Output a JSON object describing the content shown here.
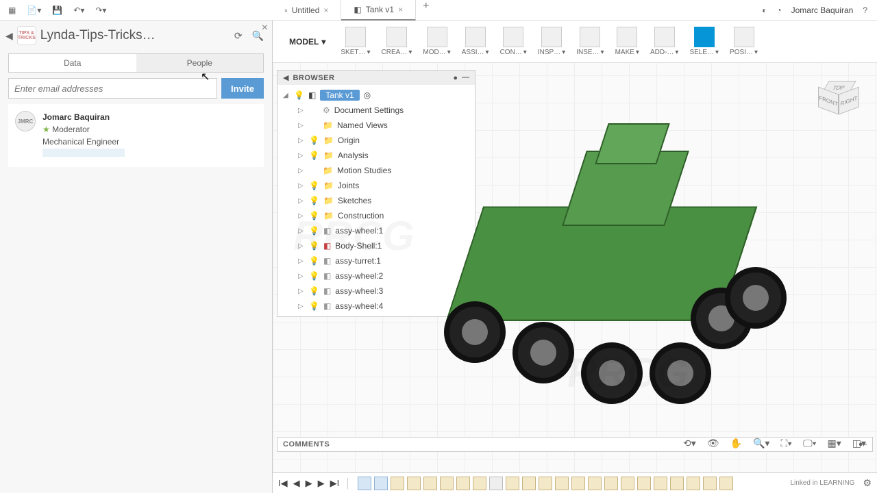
{
  "topbar": {
    "tabs": [
      {
        "label": "Untitled",
        "icon": "document-icon"
      },
      {
        "label": "Tank v1",
        "icon": "component-icon"
      }
    ],
    "user": "Jomarc Baquiran"
  },
  "panel": {
    "title": "Lynda-Tips-Tricks…",
    "logo_text": "TIPS & TRICKS",
    "tabs": {
      "data": "Data",
      "people": "People"
    },
    "invite_placeholder": "Enter email addresses",
    "invite_button": "Invite",
    "person": {
      "avatar_text": "JMRC",
      "name": "Jomarc Baquiran",
      "role": "Moderator",
      "title": "Mechanical Engineer"
    }
  },
  "ribbon": {
    "workspace": "MODEL",
    "groups": [
      "SKET…",
      "CREA…",
      "MOD…",
      "ASSI…",
      "CON…",
      "INSP…",
      "INSE…",
      "MAKE",
      "ADD-…",
      "SELE…",
      "POSI…"
    ]
  },
  "browser": {
    "header": "BROWSER",
    "root": "Tank v1",
    "items": [
      {
        "label": "Document Settings",
        "bulb": null,
        "icon": "gear"
      },
      {
        "label": "Named Views",
        "bulb": null,
        "icon": "folder"
      },
      {
        "label": "Origin",
        "bulb": "off",
        "icon": "folder"
      },
      {
        "label": "Analysis",
        "bulb": "on",
        "icon": "folder"
      },
      {
        "label": "Motion Studies",
        "bulb": null,
        "icon": "folder"
      },
      {
        "label": "Joints",
        "bulb": "on",
        "icon": "folder"
      },
      {
        "label": "Sketches",
        "bulb": "on",
        "icon": "folder"
      },
      {
        "label": "Construction",
        "bulb": "on",
        "icon": "folder"
      },
      {
        "label": "assy-wheel:1",
        "bulb": "on",
        "icon": "component"
      },
      {
        "label": "Body-Shell:1",
        "bulb": "on",
        "icon": "component-red"
      },
      {
        "label": "assy-turret:1",
        "bulb": "on",
        "icon": "component"
      },
      {
        "label": "assy-wheel:2",
        "bulb": "on",
        "icon": "component"
      },
      {
        "label": "assy-wheel:3",
        "bulb": "on",
        "icon": "component"
      },
      {
        "label": "assy-wheel:4",
        "bulb": "on",
        "icon": "component"
      }
    ]
  },
  "viewcube": {
    "top": "TOP",
    "front": "FRONT",
    "right": "RIGHT"
  },
  "comments": {
    "header": "COMMENTS"
  },
  "timeline": {
    "brand": "Linked in LEARNING"
  },
  "watermark": "RRCG"
}
